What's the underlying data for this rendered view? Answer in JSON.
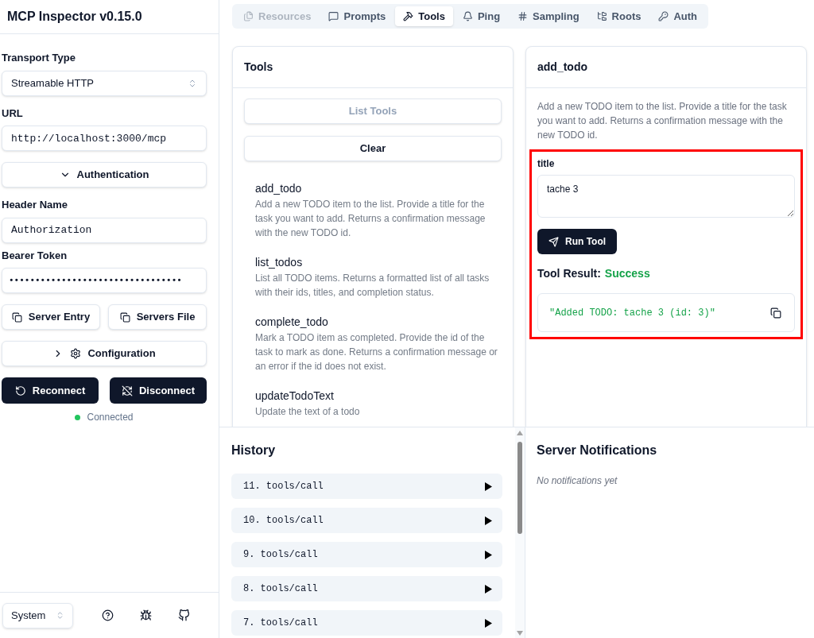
{
  "sidebar": {
    "title": "MCP Inspector v0.15.0",
    "transport": {
      "label": "Transport Type",
      "value": "Streamable HTTP"
    },
    "url": {
      "label": "URL",
      "value": "http://localhost:3000/mcp"
    },
    "authentication": {
      "label": "Authentication",
      "expanded": true
    },
    "header_name": {
      "label": "Header Name",
      "value": "Authorization"
    },
    "bearer_token": {
      "label": "Bearer Token",
      "value": "•••••••••••••••••••••••••••••••••"
    },
    "copy_buttons": [
      "Server Entry",
      "Servers File"
    ],
    "configuration": {
      "label": "Configuration",
      "expanded": false
    },
    "reconnect": "Reconnect",
    "disconnect": "Disconnect",
    "status": {
      "text": "Connected",
      "connected": true
    },
    "theme": "System"
  },
  "tabs": [
    {
      "label": "Resources",
      "selected": false,
      "disabled": true
    },
    {
      "label": "Prompts",
      "selected": false,
      "disabled": false
    },
    {
      "label": "Tools",
      "selected": true,
      "disabled": false
    },
    {
      "label": "Ping",
      "selected": false,
      "disabled": false
    },
    {
      "label": "Sampling",
      "selected": false,
      "disabled": false
    },
    {
      "label": "Roots",
      "selected": false,
      "disabled": false
    },
    {
      "label": "Auth",
      "selected": false,
      "disabled": false
    }
  ],
  "tools_panel": {
    "title": "Tools",
    "list_button": {
      "label": "List Tools",
      "disabled": true
    },
    "clear_button": "Clear",
    "tools": [
      {
        "name": "add_todo",
        "description": "Add a new TODO item to the list. Provide a title for the task you want to add. Returns a confirmation message with the new TODO id."
      },
      {
        "name": "list_todos",
        "description": "List all TODO items. Returns a formatted list of all tasks with their ids, titles, and completion status."
      },
      {
        "name": "complete_todo",
        "description": "Mark a TODO item as completed. Provide the id of the task to mark as done. Returns a confirmation message or an error if the id does not exist."
      },
      {
        "name": "updateTodoText",
        "description": "Update the text of a todo"
      }
    ]
  },
  "tool_detail": {
    "title": "add_todo",
    "description": "Add a new TODO item to the list. Provide a title for the task you want to add. Returns a confirmation message with the new TODO id.",
    "params": [
      {
        "label": "title",
        "value": "tache 3"
      }
    ],
    "run_button": "Run Tool",
    "result": {
      "label": "Tool Result:",
      "status": "Success",
      "output": "\"Added TODO: tache 3 (id: 3)\""
    }
  },
  "history": {
    "title": "History",
    "items": [
      {
        "label": "11. tools/call",
        "expanded": false
      },
      {
        "label": "10. tools/call",
        "expanded": false
      },
      {
        "label": "9. tools/call",
        "expanded": false
      },
      {
        "label": "8. tools/call",
        "expanded": false
      },
      {
        "label": "7. tools/call",
        "expanded": false
      }
    ]
  },
  "notifications": {
    "title": "Server Notifications",
    "empty": "No notifications yet"
  }
}
